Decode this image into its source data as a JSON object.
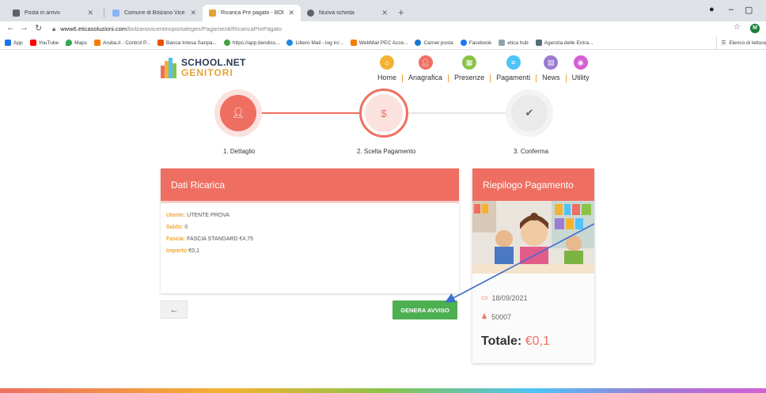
{
  "browser": {
    "tabs": [
      {
        "title": "Posta in arrivo",
        "color": "#5f6368"
      },
      {
        "title": "Comune di Bolzano Vicentino - ",
        "color": "#8ab4f8"
      },
      {
        "title": "Ricarica Pre pagato - BOLZANO",
        "color": "#e8a23a"
      },
      {
        "title": "Nuova scheda",
        "color": "#5f6368"
      }
    ],
    "url_host": "www6.eticasoluzioni.com",
    "url_path": "/bolzanovicentinoportalegen/Pagamenti/RicaricaPrePagato",
    "profile_initial": "M",
    "bookmarks": [
      {
        "label": "App",
        "color": "#1a73e8"
      },
      {
        "label": "YouTube",
        "color": "#ff0000"
      },
      {
        "label": "Maps",
        "color": "#34a853"
      },
      {
        "label": "Aruba.it - Control P...",
        "color": "#f57c00"
      },
      {
        "label": "Banca Intesa Sanpa...",
        "color": "#e65100"
      },
      {
        "label": "https://app.tiendiss...",
        "color": "#43a047"
      },
      {
        "label": "Libero Mail - log in/...",
        "color": "#1e88e5"
      },
      {
        "label": "WebMail PEC Acce...",
        "color": "#f57c00"
      },
      {
        "label": "Carnet posta",
        "color": "#1976d2"
      },
      {
        "label": "Facebook",
        "color": "#1877f2"
      },
      {
        "label": "etica hub",
        "color": "#90a4ae"
      },
      {
        "label": "Agenzia delle Entra...",
        "color": "#546e7a"
      }
    ],
    "bookmarks_other": "Elenco di lettura"
  },
  "site": {
    "logo_line1": "SCHOOL.NET",
    "logo_line2": "GENITORI",
    "nav": [
      {
        "label": "Home",
        "color": "#f4b233",
        "icon": "home-icon"
      },
      {
        "label": "Anagrafica",
        "color": "#ee6f61",
        "icon": "user-icon"
      },
      {
        "label": "Presenze",
        "color": "#8bc34a",
        "icon": "calendar-icon"
      },
      {
        "label": "Pagamenti",
        "color": "#4fc3f7",
        "icon": "list-icon"
      },
      {
        "label": "News",
        "color": "#9c7bd4",
        "icon": "news-icon"
      },
      {
        "label": "Utility",
        "color": "#d55fd6",
        "icon": "utility-icon"
      }
    ]
  },
  "steps": [
    {
      "label": "1. Dettaglio",
      "state": "done",
      "icon": "user-icon"
    },
    {
      "label": "2. Scelta Pagamento",
      "state": "current",
      "icon": "dollar-icon",
      "glyph": "$"
    },
    {
      "label": "3. Conferma",
      "state": "pending",
      "icon": "check-icon"
    }
  ],
  "dati": {
    "title": "Dati Ricarica",
    "fields": [
      {
        "key": "Utente:",
        "value": "UTENTE PROVA"
      },
      {
        "key": "Saldo:",
        "value": "0"
      },
      {
        "key": "Fascia:",
        "value": "FASCIA STANDARD €4,75"
      },
      {
        "key": "Importo:",
        "value": "€0,1"
      }
    ]
  },
  "riepilogo": {
    "title": "Riepilogo Pagamento",
    "date": "18/09/2021",
    "code": "50007",
    "total_label": "Totale:",
    "total_value": "€0,1"
  },
  "buttons": {
    "back": "←",
    "generate": "GENERA AVVISO"
  },
  "colors": {
    "accent": "#ee6f61",
    "success": "#4caf50",
    "label": "#f0a732"
  }
}
